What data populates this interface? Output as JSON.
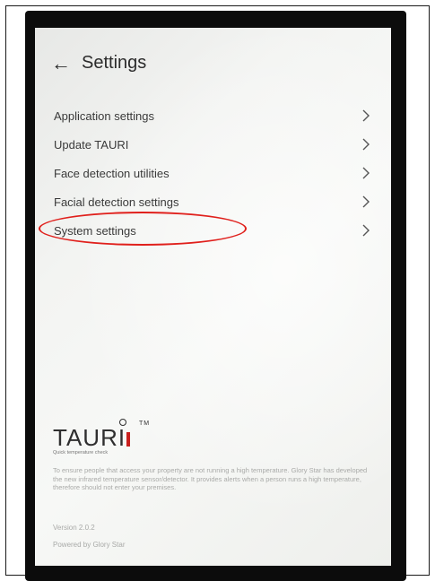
{
  "header": {
    "back_icon": "arrow-left-icon",
    "title": "Settings"
  },
  "menu": {
    "items": [
      {
        "label": "Application settings",
        "icon": "chevron-right-icon"
      },
      {
        "label": "Update TAURI",
        "icon": "chevron-right-icon"
      },
      {
        "label": "Face detection utilities",
        "icon": "chevron-right-icon"
      },
      {
        "label": "Facial detection settings",
        "icon": "chevron-right-icon"
      },
      {
        "label": "System settings",
        "icon": "chevron-right-icon"
      }
    ]
  },
  "brand": {
    "logo_text": "TAURI",
    "trademark": "TM",
    "tagline": "Quick temperature check",
    "description": "To ensure people that access your property are not running a high temperature. Glory Star has developed the new infrared temperature sensor/detector. It provides alerts when a person runs a high temperature, therefore should not enter your premises."
  },
  "footer": {
    "version": "Version 2.0.2",
    "powered_by": "Powered by Glory Star"
  },
  "colors": {
    "highlight": "#e0201c",
    "logo_accent": "#c9201e",
    "text_primary": "#3a3a3a",
    "text_muted": "#a9aaa8"
  }
}
